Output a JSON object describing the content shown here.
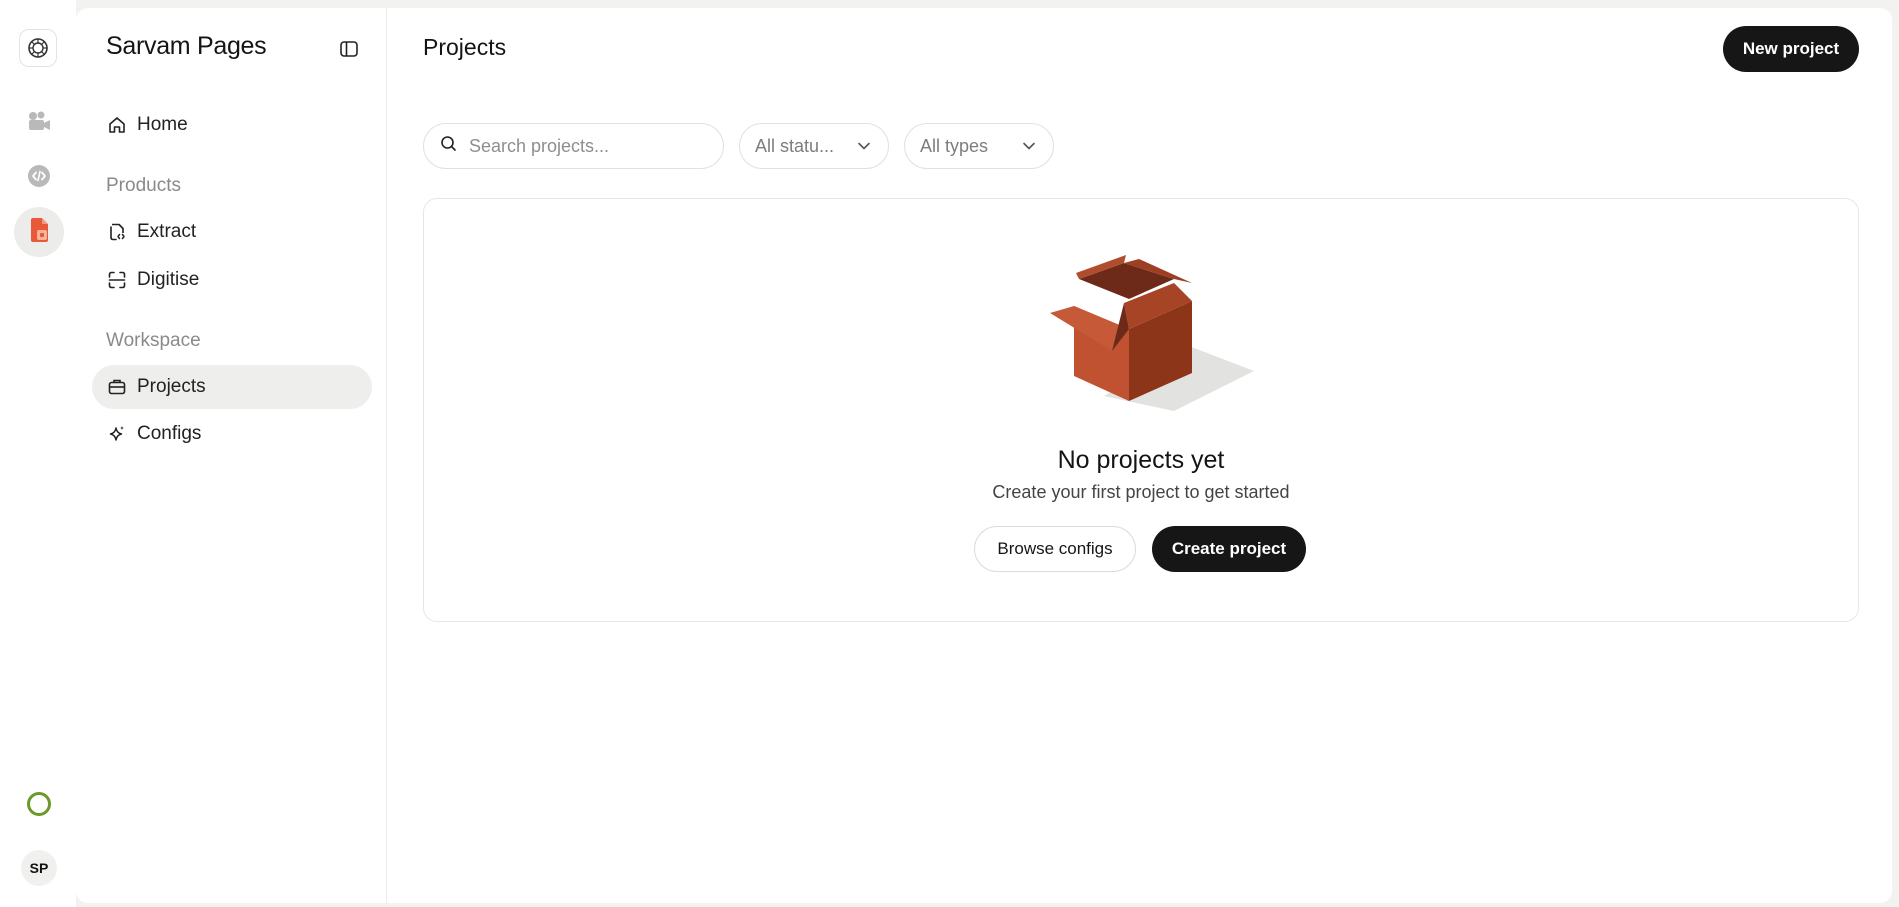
{
  "rail": {
    "logo_icon": "sarvam-logo-icon",
    "items": [
      {
        "icon": "camera-icon",
        "active": false
      },
      {
        "icon": "code-icon",
        "active": false
      },
      {
        "icon": "pages-doc-icon",
        "active": true
      }
    ],
    "status_color": "#6b9a2a",
    "avatar_initials": "SP"
  },
  "sidebar": {
    "brand": "Sarvam Pages",
    "home_label": "Home",
    "products_section": "Products",
    "extract_label": "Extract",
    "digitise_label": "Digitise",
    "workspace_section": "Workspace",
    "projects_label": "Projects",
    "configs_label": "Configs"
  },
  "header": {
    "title": "Projects",
    "new_project_label": "New project"
  },
  "filters": {
    "search_placeholder": "Search projects...",
    "status_value": "All statu...",
    "type_value": "All types"
  },
  "empty_state": {
    "title": "No projects yet",
    "subtitle": "Create your first project to get started",
    "browse_label": "Browse configs",
    "create_label": "Create project"
  },
  "colors": {
    "accent_dark": "#161616",
    "box_orange": "#c2502f",
    "status_green": "#6b9a2a"
  }
}
